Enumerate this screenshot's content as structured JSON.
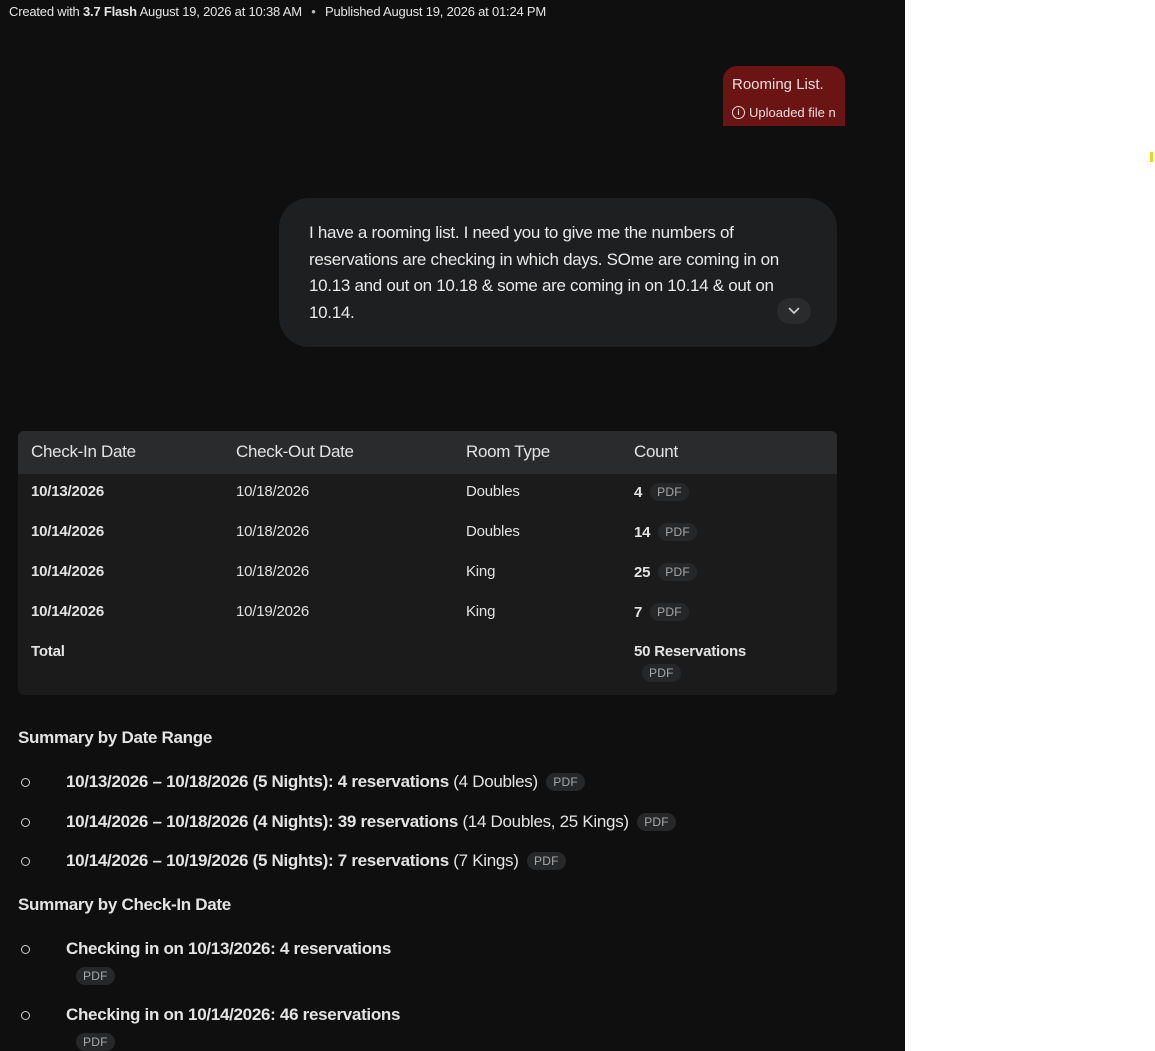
{
  "meta": {
    "created_prefix": "Created with",
    "model": "3.7 Flash",
    "created_at": "August 19, 2026 at 10:38 AM",
    "separator": "•",
    "published": "Published August 19, 2026 at 01:24 PM"
  },
  "file_chip": {
    "name": "Rooming List.",
    "status": "Uploaded file n",
    "info_glyph": "i",
    "color": "#6b1414"
  },
  "user_message": {
    "text": "I have a rooming list. I need you to give me the numbers of reservations are checking in which days. SOme are coming in on 10.13 and out on 10.18 & some are coming in on 10.14 & out on 10.14."
  },
  "table": {
    "headers": [
      "Check-In Date",
      "Check-Out Date",
      "Room Type",
      "Count"
    ],
    "rows": [
      {
        "checkin": "10/13/2026",
        "checkout": "10/18/2026",
        "room": "Doubles",
        "count": "4",
        "tag": "PDF"
      },
      {
        "checkin": "10/14/2026",
        "checkout": "10/18/2026",
        "room": "Doubles",
        "count": "14",
        "tag": "PDF"
      },
      {
        "checkin": "10/14/2026",
        "checkout": "10/18/2026",
        "room": "King",
        "count": "25",
        "tag": "PDF"
      },
      {
        "checkin": "10/14/2026",
        "checkout": "10/19/2026",
        "room": "King",
        "count": "7",
        "tag": "PDF"
      }
    ],
    "total": {
      "label": "Total",
      "count": "50 Reservations",
      "tag": "PDF"
    }
  },
  "summary_range": {
    "title": "Summary by Date Range",
    "items": [
      {
        "bold": "10/13/2026 – 10/18/2026 (5 Nights): 4 reservations",
        "rest": " (4 Doubles)",
        "tag": "PDF"
      },
      {
        "bold": "10/14/2026 – 10/18/2026 (4 Nights): 39 reservations",
        "rest": " (14 Doubles, 25 Kings)",
        "tag": "PDF"
      },
      {
        "bold": "10/14/2026 – 10/19/2026 (5 Nights): 7 reservations",
        "rest": " (7 Kings)",
        "tag": "PDF"
      }
    ]
  },
  "summary_checkin": {
    "title": "Summary by Check-In Date",
    "items": [
      {
        "bold": "Checking in on 10/13/2026: 4 reservations",
        "tag": "PDF"
      },
      {
        "bold": "Checking in on 10/14/2026: 46 reservations",
        "tag": "PDF"
      }
    ]
  },
  "colors": {
    "panel_bg": "#0f0f10",
    "bubble_bg": "#1e1f20",
    "table_header_bg": "#2a2b2d",
    "marker": "#f2d21b"
  }
}
